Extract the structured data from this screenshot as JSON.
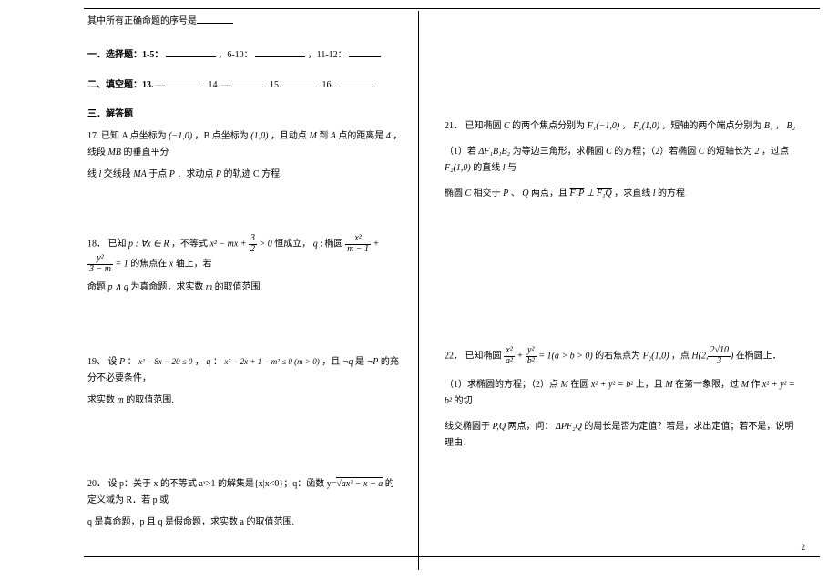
{
  "top_note": "其中所有正确命题的序号是",
  "sections": {
    "one_label": "一．选择题：1-5：",
    "one_mid": "，6-10：",
    "one_end": "，11-12：",
    "two_label": "二、填空题：13.",
    "two_14": "14.",
    "two_15": "15.",
    "two_16": "16.",
    "three_label": "三．解答题"
  },
  "q17": {
    "num": "17.",
    "text_a": "已知 A 点坐标为",
    "pt_a": "(−1,0)",
    "text_b": "，B 点坐标为",
    "pt_b": "(1,0)",
    "text_c": "，且动点",
    "M": "M",
    "text_d": "到",
    "A": "A",
    "text_e": "点的距离是",
    "dist": "4",
    "text_f": "，线段",
    "MB": "MB",
    "text_g": "的垂直平分",
    "line2a": "线",
    "l": "l",
    "line2b": "交线段",
    "MA": "MA",
    "line2c": "于点",
    "P": "P",
    "line2d": "．求动点",
    "line2e": "的轨迹 C 方程."
  },
  "q18": {
    "num": "18．",
    "text_a": "已知",
    "p_def": "p : ∀x ∈ R",
    "text_b": "，不等式",
    "ineq_l": "x² − mx +",
    "frac_num": "3",
    "frac_den": "2",
    "ineq_r": "> 0",
    "text_c": "恒成立，",
    "q": "q",
    "text_d": " : 椭圆",
    "f1n": "x²",
    "f1d": "m − 1",
    "plus": "+",
    "f2n": "y²",
    "f2d": "3 − m",
    "eq1": "= 1",
    "text_e": "的焦点在",
    "xaxis": "x",
    "text_f": "轴上，若",
    "line2": "命题",
    "pq": "p ∧ q",
    "line2b": "为真命题，求实数",
    "mvar": "m",
    "line2c": "的取值范围."
  },
  "q19": {
    "num": "19、",
    "text_a": "设",
    "Pv": "P",
    "colon1": "：",
    "ineq1": "x² − 8x − 20 ≤ 0",
    "comma": "，",
    "qv": "q",
    "colon2": "：",
    "ineq2": "x² − 2x + 1 − m² ≤ 0 (m > 0)",
    "text_b": "，且",
    "neg_q": "¬q",
    "text_c": "是",
    "neg_p": "¬P",
    "text_d": "的充分不必要条件，",
    "line2": "求实数",
    "mv": "m",
    "line2b": "的取值范围."
  },
  "q20": {
    "num": "20．",
    "text_a": "设 p：关于 x 的不等式 aˣ>1 的解集是{x|x<0}；q：函数 y=",
    "sqrt_inner": "ax² − x + a",
    "text_b": "的定义域为 R．若 p 或",
    "line2": "q 是真命题，p 且 q 是假命题，求实数 a 的取值范围."
  },
  "q21": {
    "num": "21．",
    "text_a": "已知椭圆",
    "C": "C",
    "text_b": "的两个焦点分别为",
    "F1": "F₁(−1,0)",
    "comma1": "，",
    "F2": "F₂(1,0)",
    "text_c": "，短轴的两个端点分别为",
    "B1": "B₁",
    "comma2": "，",
    "B2": "B₂",
    "line2a": "（1）若",
    "tri": "ΔF₁B₁B₂",
    "line2b": "为等边三角形，求椭圆",
    "line2c": "的方程；（2）若椭圆",
    "line2d": "的短轴长为",
    "two": "2",
    "line2e": "，过点",
    "line2f": "的直线",
    "lv": "l",
    "line2g": "与",
    "line3a": "椭圆",
    "line3b": "相交于",
    "Pv": "P",
    "line3c": "、",
    "Q": "Q",
    "line3d": "两点，且",
    "vec1": "F₁P",
    "perp": "⊥",
    "vec2": "F₁Q",
    "line3e": "，求直线",
    "line3f": "的方程"
  },
  "q22": {
    "num": "22．",
    "text_a": "已知椭圆",
    "f1n": "x²",
    "f1d": "a²",
    "plus": "+",
    "f2n": "y²",
    "f2d": "b²",
    "eq": "= 1(a > b > 0)",
    "text_b": "的右焦点为",
    "F2": "F₂(1,0)",
    "text_c": "，点",
    "H_l": "H(2,",
    "H_fn": "2√10",
    "H_fd": "3",
    "H_r": ")",
    "text_d": "在椭圆上．",
    "line2a": "（1）求椭圆的方程；（2）点",
    "M": "M",
    "line2b": "在圆",
    "circ": "x² + y² = b²",
    "line2c": "上，且",
    "line2d": "在第一象限，过",
    "line2e": "作",
    "line2f": "的切",
    "line3a": "线交椭圆于",
    "PQ": "P,Q",
    "line3b": "两点，问：",
    "tri2": "ΔPF₂Q",
    "line3c": "的周长是否为定值？若是，求出定值；若不是，说明理由．"
  },
  "page_number": "2"
}
